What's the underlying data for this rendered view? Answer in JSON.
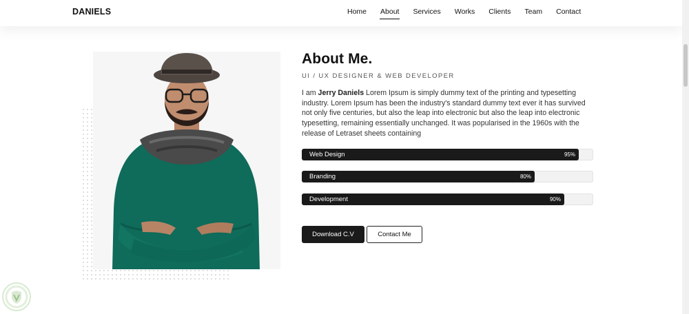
{
  "header": {
    "logo": "DANIELS",
    "nav": [
      {
        "label": "Home"
      },
      {
        "label": "About"
      },
      {
        "label": "Services"
      },
      {
        "label": "Works"
      },
      {
        "label": "Clients"
      },
      {
        "label": "Team"
      },
      {
        "label": "Contact"
      }
    ]
  },
  "about": {
    "title": "About Me.",
    "subtitle": "UI / UX DESIGNER & WEB DEVELOPER",
    "intro_prefix": "I am ",
    "name": "Jerry Daniels",
    "intro_rest": " Lorem Ipsum is simply dummy text of the printing and typesetting industry. Lorem Ipsum has been the industry's standard dummy text ever it has survived not only five centuries, but also the leap into electronic but also the leap into electronic typesetting, remaining essentially unchanged. It was popularised in the 1960s with the release of Letraset sheets containing"
  },
  "skills": [
    {
      "label": "Web Design",
      "percent_text": "95%",
      "percent": 95
    },
    {
      "label": "Branding",
      "percent_text": "80%",
      "percent": 80
    },
    {
      "label": "Development",
      "percent_text": "90%",
      "percent": 90
    }
  ],
  "buttons": {
    "download": "Download C.V",
    "contact": "Contact Me"
  },
  "colors": {
    "accent": "#1a1a1a",
    "sweater": "#0f6b5a",
    "background": "#ffffff"
  },
  "icons": {
    "badge": "shield-badge-icon"
  }
}
